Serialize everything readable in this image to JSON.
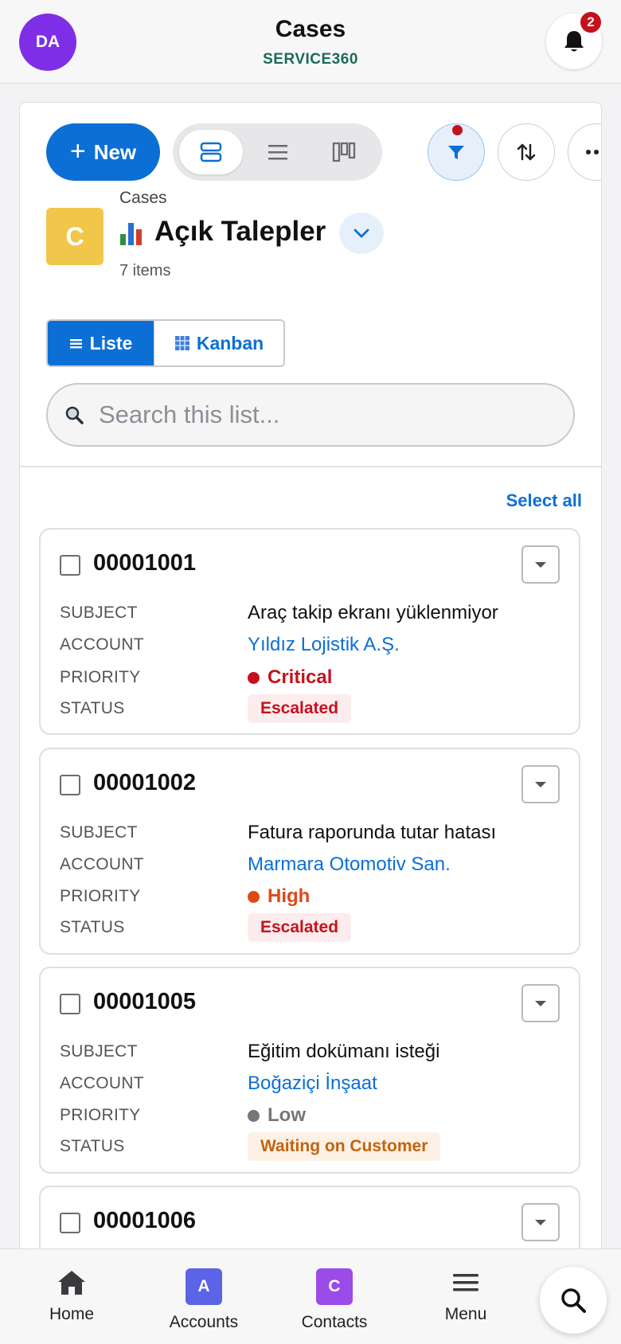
{
  "header": {
    "avatar_initials": "DA",
    "title": "Cases",
    "subtitle": "SERVICE360",
    "notification_count": "2"
  },
  "toolbar": {
    "new_label": "New",
    "view_options": [
      "table-view-icon",
      "list-view-icon",
      "kanban-view-icon"
    ],
    "active_view": "table-view-icon"
  },
  "list_header": {
    "object_icon_letter": "C",
    "breadcrumb": "Cases",
    "list_name": "Açık Talepler",
    "item_count": "7 items"
  },
  "view_toggle": {
    "list_label": "Liste",
    "kanban_label": "Kanban",
    "selected": "Liste"
  },
  "search": {
    "placeholder": "Search this list...",
    "value": ""
  },
  "select_all_label": "Select all",
  "field_labels": {
    "subject": "SUBJECT",
    "account": "ACCOUNT",
    "priority": "PRIORITY",
    "status": "STATUS"
  },
  "records": [
    {
      "number": "00001001",
      "subject": "Araç takip ekranı yüklenmiyor",
      "account": "Yıldız Lojistik A.Ş.",
      "priority": "Critical",
      "priority_color": "#c4121d",
      "status": "Escalated",
      "status_color": "#c4121d",
      "status_bg": "#fdeced"
    },
    {
      "number": "00001002",
      "subject": "Fatura raporunda tutar hatası",
      "account": "Marmara Otomotiv San.",
      "priority": "High",
      "priority_color": "#e0481a",
      "status": "Escalated",
      "status_color": "#c4121d",
      "status_bg": "#fdeced"
    },
    {
      "number": "00001005",
      "subject": "Eğitim dokümanı isteği",
      "account": "Boğaziçi İnşaat",
      "priority": "Low",
      "priority_color": "#76767b",
      "status": "Waiting on Customer",
      "status_color": "#c2640e",
      "status_bg": "#fdf1e6"
    },
    {
      "number": "00001006"
    }
  ],
  "bottom_nav": {
    "home_label": "Home",
    "accounts_label": "Accounts",
    "accounts_letter": "A",
    "contacts_label": "Contacts",
    "contacts_letter": "C",
    "menu_label": "Menu"
  },
  "colors": {
    "brand": "#0b6fd6",
    "avatar": "#7f2ee8",
    "accounts_tile": "#5b63e6",
    "contacts_tile": "#9a4be8",
    "cases_icon": "#f0c74a"
  }
}
